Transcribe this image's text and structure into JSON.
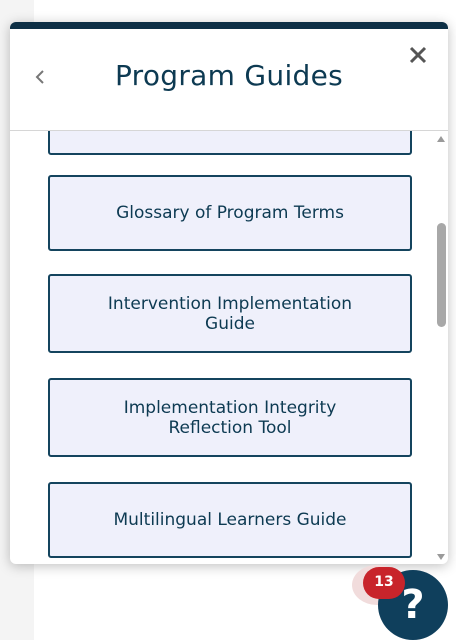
{
  "panel": {
    "title": "Program Guides",
    "back_icon": "chevron-left-icon",
    "close_icon": "close-icon"
  },
  "guides": [
    {
      "label": ""
    },
    {
      "label": "Glossary of Program Terms"
    },
    {
      "label": "Intervention Implementation Guide"
    },
    {
      "label": "Implementation Integrity Reflection Tool"
    },
    {
      "label": "Multilingual Learners Guide"
    }
  ],
  "help": {
    "icon": "question-mark-icon",
    "glyph": "?",
    "badge_count": "13"
  },
  "colors": {
    "accent": "#0d2f45",
    "button_bg": "#eff0fb",
    "button_border": "#14445e",
    "badge": "#c8242b"
  }
}
